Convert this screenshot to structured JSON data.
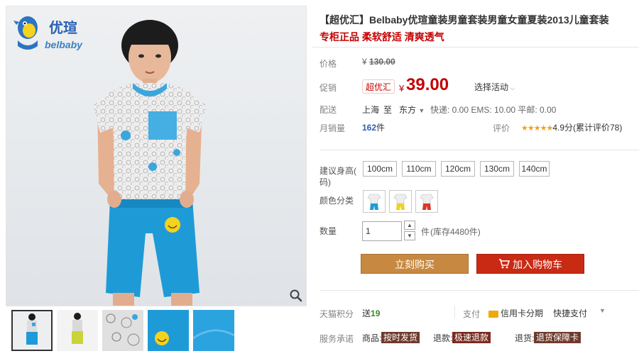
{
  "brand": {
    "cn": "优瑄",
    "en": "belbaby"
  },
  "product": {
    "title": "【超优汇】Belbaby优瑄童装男童套装男童女童夏装2013儿童套装",
    "subtitle": "专柜正品 柔软舒适 清爽透气"
  },
  "price": {
    "label": "价格",
    "currency": "¥",
    "original": "130.00"
  },
  "promo": {
    "label": "促销",
    "badge": "超优汇",
    "currency": "¥",
    "price": "39.00",
    "select": "活动",
    "select_prefix": "选择"
  },
  "shipping": {
    "label": "配送",
    "from": "上海",
    "to_prefix": "至",
    "to": "东方",
    "fees": "快递: 0.00 EMS: 10.00 平邮: 0.00"
  },
  "sales": {
    "label": "月销量",
    "count": "162",
    "unit": "件"
  },
  "rating": {
    "label": "评价",
    "stars": "★★★★★",
    "score": "4.9分",
    "count_text": "(累计评价78)"
  },
  "height": {
    "label_line1": "建议身高(",
    "label_line2": "码)",
    "options": [
      "100cm",
      "110cm",
      "120cm",
      "130cm",
      "140cm"
    ]
  },
  "color": {
    "label": "颜色分类"
  },
  "quantity": {
    "label": "数量",
    "value": "1",
    "unit": "件",
    "stock": "(库存4480件)"
  },
  "actions": {
    "buy": "立刻购买",
    "cart": "加入购物车"
  },
  "points": {
    "label": "天猫积分",
    "prefix": "送",
    "value": "19"
  },
  "payment": {
    "label": "支付",
    "credit": "信用卡分期",
    "quick": "快捷支付"
  },
  "service": {
    "label": "服务承诺",
    "goods_label": "商品:",
    "goods_badge": "按时发货",
    "return_label": "退款:",
    "return_badge": "极速退款",
    "exchange_label": "退货:",
    "exchange_badge": "退货保障卡"
  },
  "colors": {
    "accent": "#c40000",
    "buy_button": "#c78941",
    "cart_button": "#c92a14",
    "star": "#f3a01b",
    "garment_blue": "#1e9bd7"
  }
}
